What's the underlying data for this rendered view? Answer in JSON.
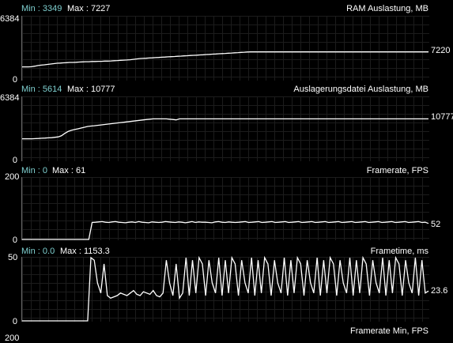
{
  "panels": [
    {
      "title": "RAM Auslastung, MB",
      "min_label": "Min : 3349",
      "max_label": "Max : 7227",
      "y_top": "6384",
      "y_bottom": "0",
      "current": "7220",
      "y_max": 16384,
      "samples": [
        3349,
        3349,
        3349,
        3400,
        3550,
        3700,
        3800,
        3900,
        4000,
        4100,
        4200,
        4300,
        4350,
        4400,
        4450,
        4500,
        4500,
        4550,
        4600,
        4650,
        4700,
        4700,
        4750,
        4750,
        4800,
        4800,
        4850,
        4850,
        4900,
        4950,
        5000,
        5050,
        5100,
        5150,
        5200,
        5300,
        5400,
        5500,
        5550,
        5600,
        5650,
        5700,
        5750,
        5800,
        5850,
        5900,
        5950,
        6000,
        6050,
        6100,
        6150,
        6200,
        6250,
        6300,
        6350,
        6400,
        6450,
        6500,
        6550,
        6600,
        6650,
        6700,
        6750,
        6800,
        6850,
        6900,
        6950,
        7000,
        7050,
        7100,
        7150,
        7200,
        7220,
        7220,
        7220,
        7220,
        7220,
        7220,
        7220,
        7220,
        7220,
        7220,
        7220,
        7220,
        7220,
        7220,
        7220,
        7220,
        7220,
        7220,
        7220,
        7220,
        7220,
        7220,
        7220,
        7227,
        7220,
        7220,
        7220,
        7220,
        7220,
        7220,
        7220,
        7220,
        7220,
        7220,
        7220,
        7220,
        7220,
        7220,
        7220,
        7220,
        7220,
        7220,
        7220,
        7220,
        7220,
        7220,
        7220,
        7220,
        7220,
        7220,
        7220,
        7220,
        7220,
        7220,
        7220,
        7220,
        7220
      ]
    },
    {
      "title": "Auslagerungsdatei Auslastung, MB",
      "min_label": "Min : 5614",
      "max_label": "Max : 10777",
      "y_top": "6384",
      "y_bottom": "0",
      "current": "10777",
      "y_max": 16384,
      "samples": [
        5614,
        5614,
        5614,
        5614,
        5650,
        5700,
        5750,
        5800,
        5850,
        5900,
        6000,
        6100,
        6400,
        7000,
        7500,
        7800,
        8000,
        8200,
        8400,
        8600,
        8800,
        8900,
        9000,
        9100,
        9200,
        9300,
        9400,
        9500,
        9600,
        9700,
        9800,
        9900,
        10000,
        10100,
        10200,
        10300,
        10400,
        10500,
        10600,
        10700,
        10777,
        10777,
        10777,
        10777,
        10777,
        10700,
        10600,
        10500,
        10777,
        10777,
        10777,
        10777,
        10777,
        10777,
        10777,
        10777,
        10777,
        10777,
        10777,
        10777,
        10777,
        10777,
        10777,
        10777,
        10777,
        10777,
        10777,
        10777,
        10777,
        10777,
        10777,
        10777,
        10777,
        10777,
        10777,
        10777,
        10777,
        10777,
        10777,
        10777,
        10777,
        10777,
        10777,
        10777,
        10777,
        10777,
        10777,
        10777,
        10777,
        10777,
        10777,
        10777,
        10777,
        10777,
        10777,
        10777,
        10777,
        10777,
        10777,
        10777,
        10777,
        10777,
        10777,
        10777,
        10777,
        10777,
        10777,
        10777,
        10777,
        10777,
        10777,
        10777,
        10777,
        10777,
        10777,
        10777,
        10777,
        10777,
        10777,
        10777,
        10777,
        10777,
        10777,
        10777,
        10777
      ]
    },
    {
      "title": "Framerate, FPS",
      "min_label": "Min : 0",
      "max_label": "Max : 61",
      "y_top": "200",
      "y_bottom": "0",
      "current": "52",
      "y_max": 200,
      "samples": [
        0,
        0,
        0,
        0,
        0,
        0,
        0,
        0,
        0,
        0,
        0,
        0,
        0,
        0,
        0,
        0,
        0,
        0,
        0,
        0,
        0,
        55,
        56,
        57,
        58,
        56,
        55,
        57,
        58,
        56,
        55,
        54,
        56,
        57,
        55,
        58,
        56,
        55,
        54,
        57,
        56,
        55,
        56,
        58,
        57,
        56,
        55,
        57,
        56,
        54,
        56,
        58,
        55,
        57,
        56,
        56,
        55,
        54,
        57,
        58,
        56,
        55,
        57,
        56,
        55,
        56,
        57,
        58,
        55,
        56,
        57,
        58,
        55,
        56,
        57,
        58,
        55,
        56,
        57,
        58,
        55,
        56,
        57,
        58,
        55,
        56,
        57,
        58,
        55,
        56,
        57,
        58,
        55,
        56,
        57,
        58,
        55,
        56,
        57,
        58,
        55,
        56,
        57,
        58,
        55,
        56,
        57,
        58,
        55,
        56,
        57,
        58,
        55,
        56,
        57,
        58,
        55,
        56,
        57,
        58,
        55,
        56,
        52
      ]
    },
    {
      "title": "Frametime, ms",
      "min_label": "Min : 0.0",
      "max_label": "Max : 1153.3",
      "y_top": "50",
      "y_bottom": "0",
      "current": "23.6",
      "y_max": 50,
      "samples": [
        0,
        0,
        0,
        0,
        0,
        0,
        0,
        0,
        0,
        0,
        0,
        0,
        0,
        0,
        0,
        0,
        0,
        0,
        0,
        0,
        0,
        50,
        48,
        30,
        22,
        45,
        20,
        18,
        19,
        20,
        22,
        21,
        20,
        22,
        24,
        21,
        20,
        23,
        22,
        21,
        24,
        20,
        19,
        22,
        48,
        30,
        20,
        45,
        18,
        22,
        50,
        20,
        48,
        22,
        50,
        45,
        20,
        48,
        30,
        22,
        50,
        20,
        48,
        22,
        50,
        45,
        20,
        48,
        30,
        22,
        50,
        20,
        48,
        22,
        50,
        45,
        20,
        48,
        30,
        22,
        50,
        20,
        48,
        22,
        50,
        45,
        20,
        48,
        30,
        22,
        50,
        20,
        48,
        22,
        50,
        45,
        20,
        48,
        30,
        22,
        50,
        20,
        48,
        22,
        50,
        45,
        20,
        48,
        30,
        22,
        50,
        20,
        48,
        22,
        50,
        45,
        20,
        48,
        30,
        22,
        50,
        20,
        48,
        22,
        23.6
      ]
    },
    {
      "title": "Framerate Min, FPS",
      "y_top": "200"
    }
  ]
}
